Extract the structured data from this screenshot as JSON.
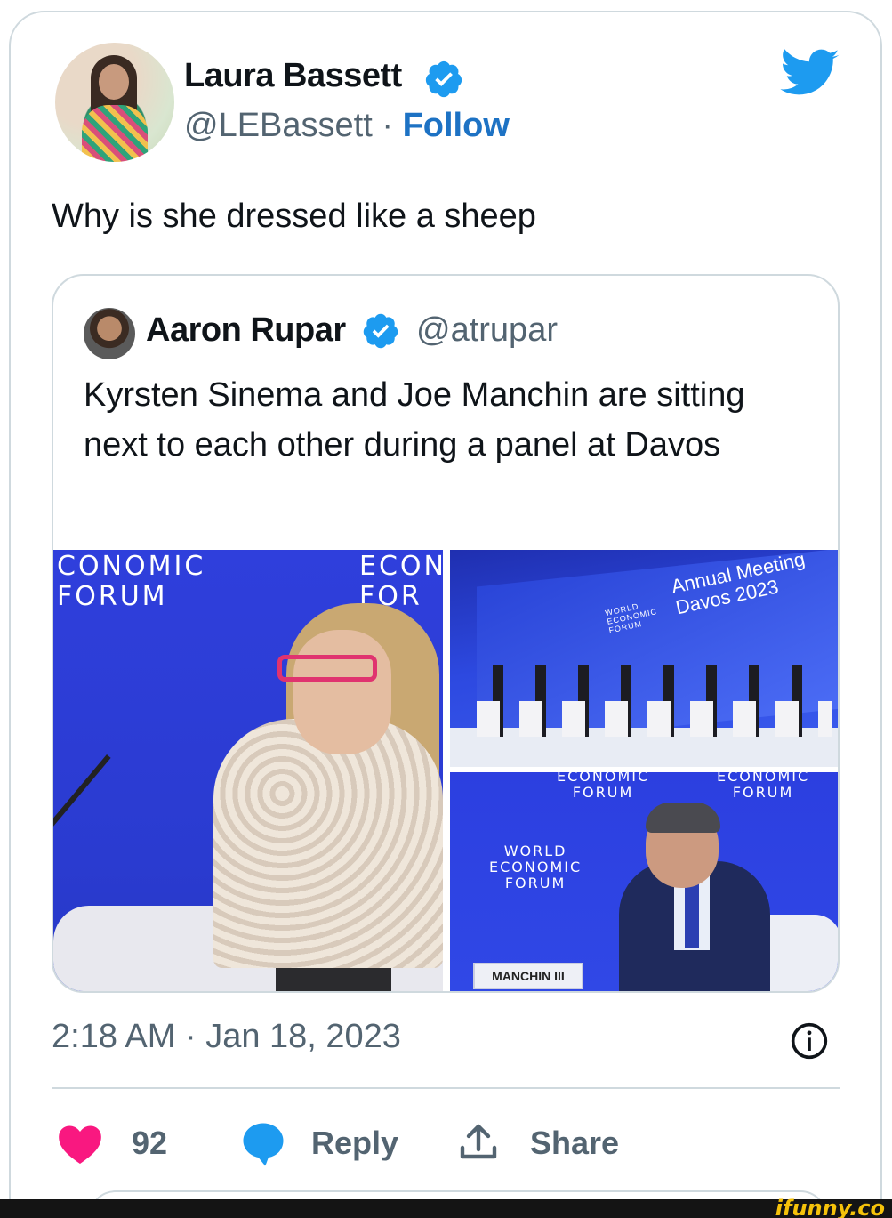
{
  "tweet": {
    "author": {
      "name": "Laura Bassett",
      "handle": "@LEBassett",
      "separator": "·",
      "follow_label": "Follow"
    },
    "text": "Why is she dressed like a sheep",
    "timestamp": "2:18 AM · Jan 18, 2023",
    "likes": "92",
    "reply_label": "Reply",
    "share_label": "Share"
  },
  "quoted_tweet": {
    "author": {
      "name": "Aaron Rupar",
      "handle": "@atrupar"
    },
    "text": "Kyrsten Sinema and Joe Manchin are sitting next to each other during a panel at Davos",
    "photos": {
      "photo1": {
        "bg_text_a": "CONOMIC\nFORUM",
        "bg_text_b": "ECON\nFOR"
      },
      "photo2": {
        "screen_title": "Annual Meeting\nDavos 2023",
        "screen_logo": "WORLD\nECONOMIC\nFORUM"
      },
      "photo3": {
        "logo_a": "ECONOMIC\nFORUM",
        "logo_b": "ECONOMIC\nFORUM",
        "logo_c": "WORLD\nECONOMIC\nFORUM",
        "nameplate": "MANCHIN III"
      }
    }
  },
  "watermark": "ifunny.co",
  "colors": {
    "verified": "#1d9bf0",
    "follow": "#1d72c4",
    "heart": "#f91880",
    "reply": "#1d9bf0",
    "muted": "#536471",
    "border": "#cfd9de"
  },
  "icons": [
    "verified-badge-icon",
    "twitter-bird-icon",
    "info-icon",
    "heart-icon",
    "reply-bubble-icon",
    "share-icon"
  ]
}
